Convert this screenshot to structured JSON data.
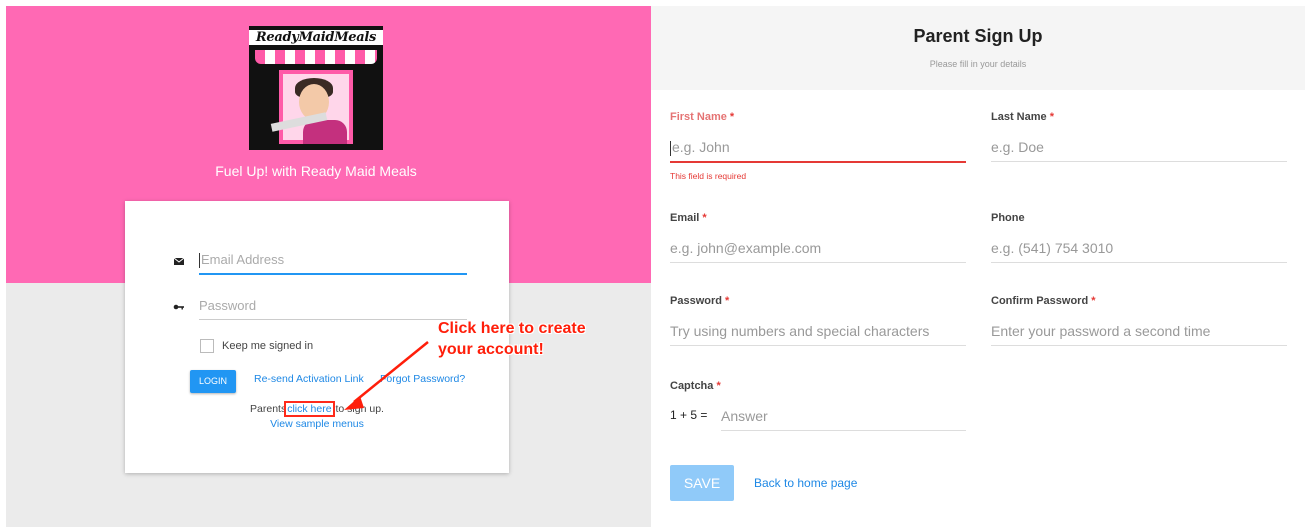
{
  "login_panel": {
    "logo_text": "ReadyMaidMeals",
    "tagline": "Fuel Up! with Ready Maid Meals",
    "email_placeholder": "Email Address",
    "password_placeholder": "Password",
    "keep_signed_in": "Keep me signed in",
    "login_button": "LOGIN",
    "resend_link": "Re-send Activation Link",
    "forgot_link": "Forgot Password?",
    "parents_prefix": "Parents",
    "click_here": "click here",
    "parents_suffix": " to sign up.",
    "sample_menus": "View sample menus",
    "icons": {
      "email": "envelope-icon",
      "password": "key-icon"
    }
  },
  "annotation": {
    "line1": "Click here to create",
    "line2": "your account!",
    "color": "#ff1e0a"
  },
  "signup_form": {
    "title": "Parent Sign Up",
    "subtitle": "Please fill in your details",
    "fields": {
      "first_name": {
        "label": "First Name",
        "required": "*",
        "placeholder": "e.g. John",
        "error": "This field is required"
      },
      "last_name": {
        "label": "Last Name",
        "required": "*",
        "placeholder": "e.g. Doe"
      },
      "email": {
        "label": "Email",
        "required": "*",
        "placeholder": "e.g. john@example.com"
      },
      "phone": {
        "label": "Phone",
        "placeholder": "e.g. (541) 754 3010"
      },
      "password": {
        "label": "Password",
        "required": "*",
        "placeholder": "Try using numbers and special characters"
      },
      "confirm_password": {
        "label": "Confirm Password",
        "required": "*",
        "placeholder": "Enter your password a second time"
      },
      "captcha": {
        "label": "Captcha",
        "required": "*",
        "question": "1 + 5 =",
        "placeholder": "Answer"
      }
    },
    "save_button": "SAVE",
    "back_link": "Back to home page"
  },
  "colors": {
    "pink_banner": "#ff69b4",
    "accent_blue": "#2196f3",
    "error_red": "#e53935",
    "save_disabled": "#90caf9"
  }
}
